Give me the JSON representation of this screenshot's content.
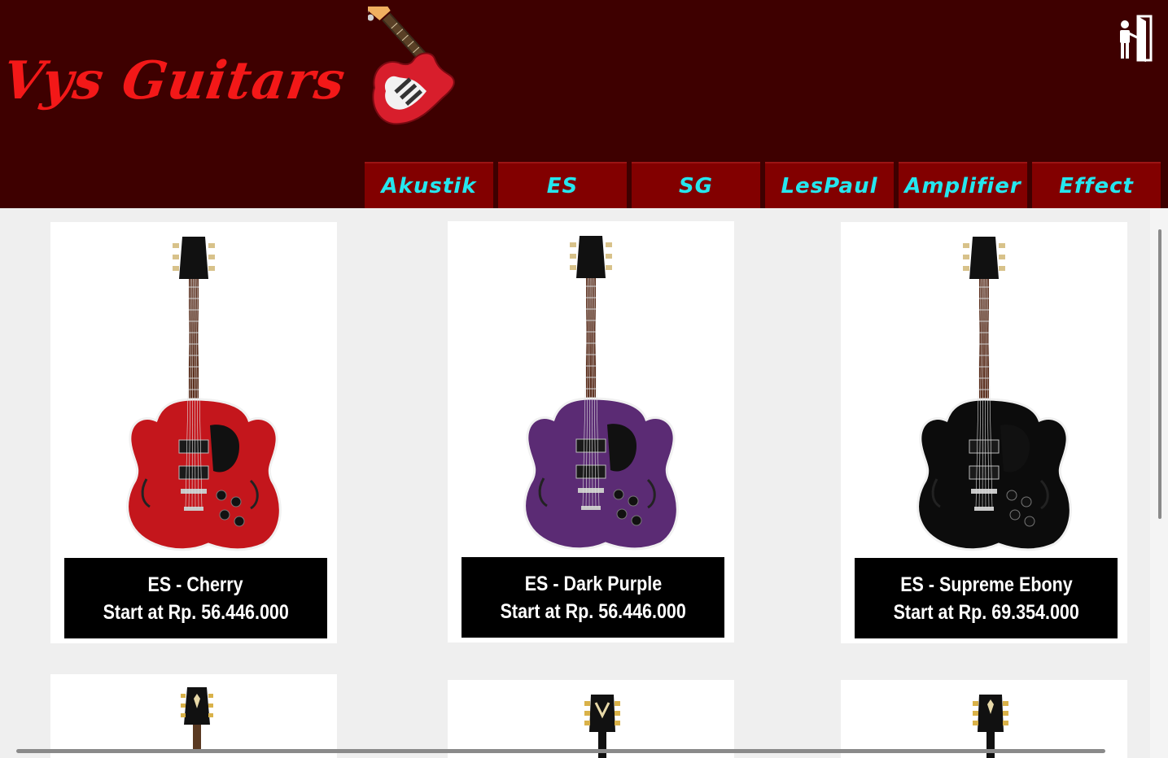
{
  "brand": {
    "name": "Vys Guitars"
  },
  "header": {
    "logout_icon": "exit-door-icon",
    "guitar_icon": "electric-guitar-icon"
  },
  "nav": {
    "items": [
      "Akustik",
      "ES",
      "SG",
      "LesPaul",
      "Amplifier",
      "Effect"
    ]
  },
  "colors": {
    "header_bg": "#3e0000",
    "nav_bg": "#820000",
    "nav_text": "#25e6ee",
    "brand_text": "#f31818",
    "caption_bg": "#000000",
    "page_bg": "#efefef"
  },
  "products": [
    {
      "name": "ES - Cherry",
      "price": "Start at Rp. 56.446.000",
      "body_color": "#c4161c"
    },
    {
      "name": "ES - Dark Purple",
      "price": "Start at Rp. 56.446.000",
      "body_color": "#5b2b74"
    },
    {
      "name": "ES - Supreme Ebony",
      "price": "Start at Rp. 69.354.000",
      "body_color": "#0c0c0c"
    }
  ]
}
